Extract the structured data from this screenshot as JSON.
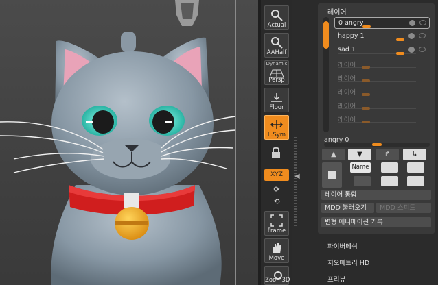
{
  "toolbar": {
    "buttons": [
      {
        "label": "Actual"
      },
      {
        "label": "AAHalf"
      },
      {
        "label": "Persp",
        "top_text": "Dynamic"
      },
      {
        "label": "Floor"
      },
      {
        "label": "L.Sym",
        "active": true
      },
      {
        "label": "XYZ",
        "active": true
      },
      {
        "label": "Frame"
      },
      {
        "label": "Move"
      },
      {
        "label": "Zoom3D"
      }
    ]
  },
  "layers_panel": {
    "title": "레이어",
    "layers": [
      {
        "name": "0 angry",
        "selected": true,
        "slider": 0.35,
        "active": true
      },
      {
        "name": "happy 1",
        "slider": 0.85,
        "active": true
      },
      {
        "name": "sad 1",
        "slider": 0.85,
        "active": true
      },
      {
        "name": "레이어",
        "slider": 0.35,
        "active": false
      },
      {
        "name": "레이어",
        "slider": 0.35,
        "active": false
      },
      {
        "name": "레이어",
        "slider": 0.35,
        "active": false
      },
      {
        "name": "레이어",
        "slider": 0.35,
        "active": false
      },
      {
        "name": "레이어",
        "slider": 0.35,
        "active": false
      }
    ],
    "angry_label": "angry 0",
    "angry_value": 0.5,
    "name_button": "Name",
    "merge_button": "레이어 통합",
    "mdd_import": "MDD 불러오기",
    "mdd_speed": "MDD 스피드",
    "record_anim": "변형 애니메이션 기록"
  },
  "menu": {
    "items": [
      "파이버메쉬",
      "지오메트리 HD",
      "프리뷰"
    ]
  },
  "colors": {
    "accent": "#f08c1e",
    "cat_body": "#8c9aa6",
    "collar": "#d01e1e",
    "bell": "#f0a818",
    "eye": "#2fbfb0"
  }
}
